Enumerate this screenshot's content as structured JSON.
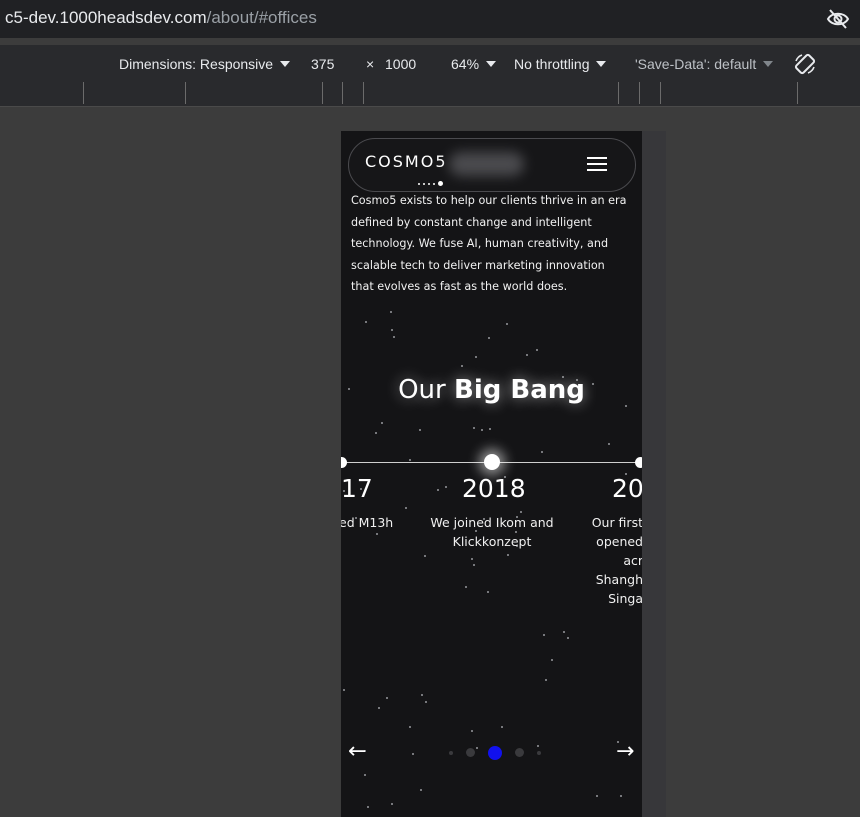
{
  "browser": {
    "url_host": "c5-dev.1000headsdev.com",
    "url_path": "/about/#offices"
  },
  "device_toolbar": {
    "dimensions_label": "Dimensions: Responsive",
    "width": "375",
    "times": "×",
    "height": "1000",
    "zoom": "64%",
    "throttling": "No throttling",
    "save_data": "'Save-Data': default"
  },
  "site": {
    "logo": "COSMO5",
    "intro": "Cosmo5 exists to help our clients thrive in an era defined by constant change and intelligent technology. We fuse AI, human creativity, and scalable tech to deliver marketing innovation that evolves as fast as the world does.",
    "heading_regular": "Our",
    "heading_bold": "Big Bang",
    "timeline": [
      {
        "year": "17",
        "text": "ed M13h"
      },
      {
        "year": "2018",
        "text": "We joined Ikom and\nKlickkonzept"
      },
      {
        "year": "20",
        "text": "Our first\nopened acr\nShangh\nSinga"
      }
    ],
    "prev_arrow": "←",
    "next_arrow": "→",
    "pager_active_index": 2,
    "accent_color": "#1111ee"
  }
}
